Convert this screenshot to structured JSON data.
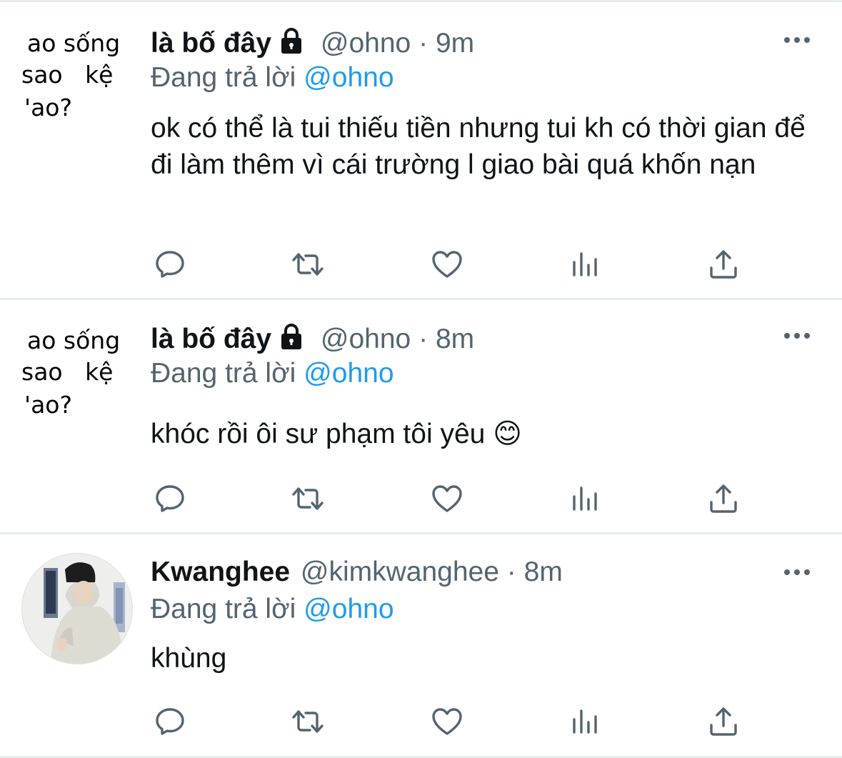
{
  "tweets": [
    {
      "avatar_lines": [
        "ao sống",
        "sao   kệ",
        "'ao?"
      ],
      "name": "là bố đây",
      "locked": true,
      "handle": "@ohno",
      "time": "9m",
      "reply_prefix": "Đang trả lời",
      "reply_to": "@ohno",
      "text": "ok có thể là tui thiếu tiền nhưng tui kh có thời gian để đi làm thêm vì cái trường l giao bài quá khốn nạn"
    },
    {
      "avatar_lines": [
        "ao sống",
        "sao   kệ",
        "'ao?"
      ],
      "name": "là bố đây",
      "locked": true,
      "handle": "@ohno",
      "time": "8m",
      "reply_prefix": "Đang trả lời",
      "reply_to": "@ohno",
      "text": "khóc rồi ôi sư phạm tôi yêu 😊"
    },
    {
      "name": "Kwanghee",
      "locked": false,
      "handle": "@kimkwanghee",
      "time": "8m",
      "reply_prefix": "Đang trả lời",
      "reply_to": "@ohno",
      "text": "khùng"
    }
  ],
  "separator": "·",
  "icons": {
    "reply": "reply-icon",
    "retweet": "retweet-icon",
    "like": "heart-icon",
    "analytics": "analytics-icon",
    "share": "share-icon",
    "more": "more-icon",
    "lock": "lock-icon"
  },
  "colors": {
    "text": "#0f1419",
    "secondary": "#536471",
    "link": "#1d9bf0",
    "divider": "#e6ecf0"
  }
}
